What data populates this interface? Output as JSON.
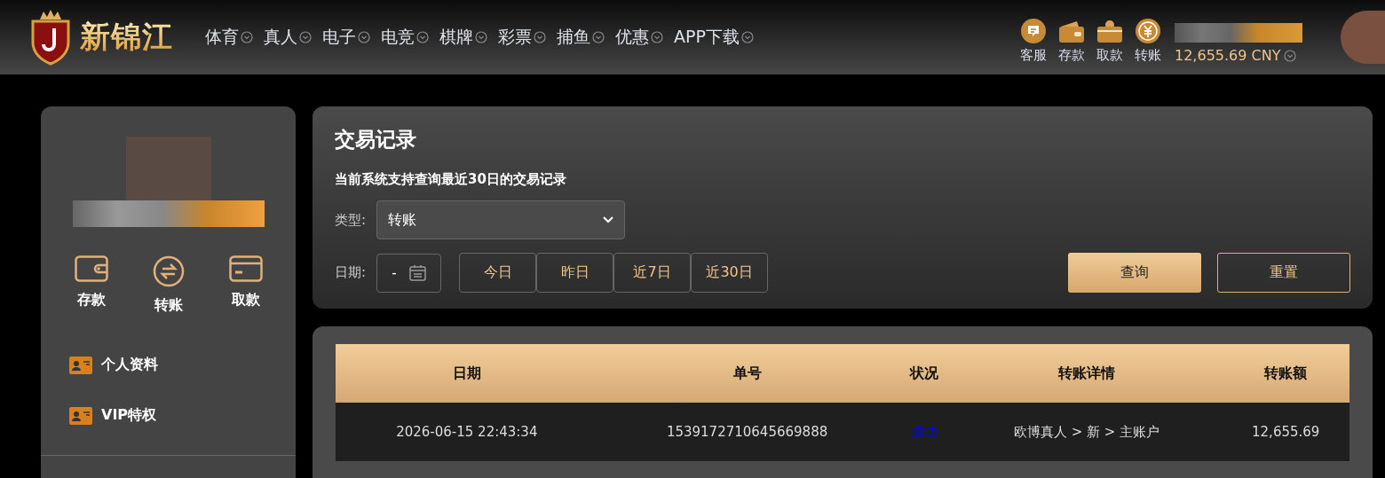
{
  "header": {
    "logo_text": "新锦江",
    "nav": [
      {
        "label": "体育"
      },
      {
        "label": "真人"
      },
      {
        "label": "电子"
      },
      {
        "label": "电竞"
      },
      {
        "label": "棋牌"
      },
      {
        "label": "彩票"
      },
      {
        "label": "捕鱼"
      },
      {
        "label": "优惠"
      },
      {
        "label": "APP下载"
      }
    ],
    "actions": [
      {
        "kind": "service",
        "label": "客服"
      },
      {
        "kind": "deposit",
        "label": "存款"
      },
      {
        "kind": "withdraw",
        "label": "取款"
      },
      {
        "kind": "transfer",
        "label": "转账"
      }
    ],
    "balance": "12,655.69 CNY"
  },
  "sidebar": {
    "quick_actions": [
      {
        "kind": "deposit",
        "label": "存款"
      },
      {
        "kind": "transfer",
        "label": "转账"
      },
      {
        "kind": "withdraw",
        "label": "取款"
      }
    ],
    "menu": [
      {
        "label": "个人资料"
      },
      {
        "label": "VIP特权"
      }
    ]
  },
  "filter": {
    "title": "交易记录",
    "note": "当前系统支持查询最近30日的交易记录",
    "type_label": "类型:",
    "type_value": "转账",
    "date_label": "日期:",
    "date_value": "-",
    "ranges": [
      {
        "label": "今日"
      },
      {
        "label": "昨日"
      },
      {
        "label": "近7日"
      },
      {
        "label": "近30日"
      }
    ],
    "buttons": [
      {
        "kind": "primary",
        "label": "查询"
      },
      {
        "kind": "outline",
        "label": "重置"
      }
    ]
  },
  "table": {
    "columns": [
      "日期",
      "单号",
      "状况",
      "转账详情",
      "转账额"
    ],
    "rows": [
      {
        "cells": [
          "2026-06-15 22:43:34",
          "1539172710645669888",
          "成功",
          "欧博真人 > 新 > 主账户",
          "12,655.69"
        ],
        "color": "#0000ff"
      }
    ]
  }
}
